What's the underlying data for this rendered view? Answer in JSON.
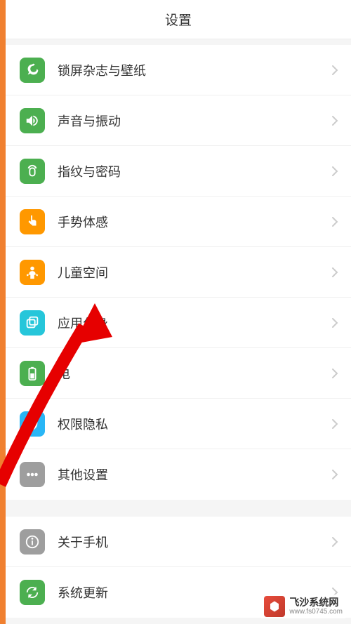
{
  "header": {
    "title": "设置"
  },
  "sections": [
    {
      "items": [
        {
          "label": "锁屏杂志与壁纸",
          "icon_name": "wallpaper-icon",
          "icon_bg": "#4caf50"
        },
        {
          "label": "声音与振动",
          "icon_name": "sound-icon",
          "icon_bg": "#4caf50"
        },
        {
          "label": "指纹与密码",
          "icon_name": "fingerprint-icon",
          "icon_bg": "#4caf50"
        },
        {
          "label": "手势体感",
          "icon_name": "gesture-icon",
          "icon_bg": "#ff9800"
        },
        {
          "label": "儿童空间",
          "icon_name": "child-icon",
          "icon_bg": "#ff9800"
        },
        {
          "label": "应用分身",
          "icon_name": "clone-icon",
          "icon_bg": "#26c6da"
        },
        {
          "label": "电",
          "icon_name": "battery-icon",
          "icon_bg": "#4caf50"
        },
        {
          "label": "权限隐私",
          "icon_name": "privacy-icon",
          "icon_bg": "#29b6f6"
        },
        {
          "label": "其他设置",
          "icon_name": "more-icon",
          "icon_bg": "#9e9e9e"
        }
      ]
    },
    {
      "items": [
        {
          "label": "关于手机",
          "icon_name": "about-icon",
          "icon_bg": "#9e9e9e"
        },
        {
          "label": "系统更新",
          "icon_name": "update-icon",
          "icon_bg": "#4caf50"
        }
      ]
    }
  ],
  "watermark": {
    "title": "飞沙系统网",
    "url": "www.fs0745.com"
  },
  "arrow_annotation": {
    "target_label": "应用分身",
    "color": "#e60000"
  }
}
